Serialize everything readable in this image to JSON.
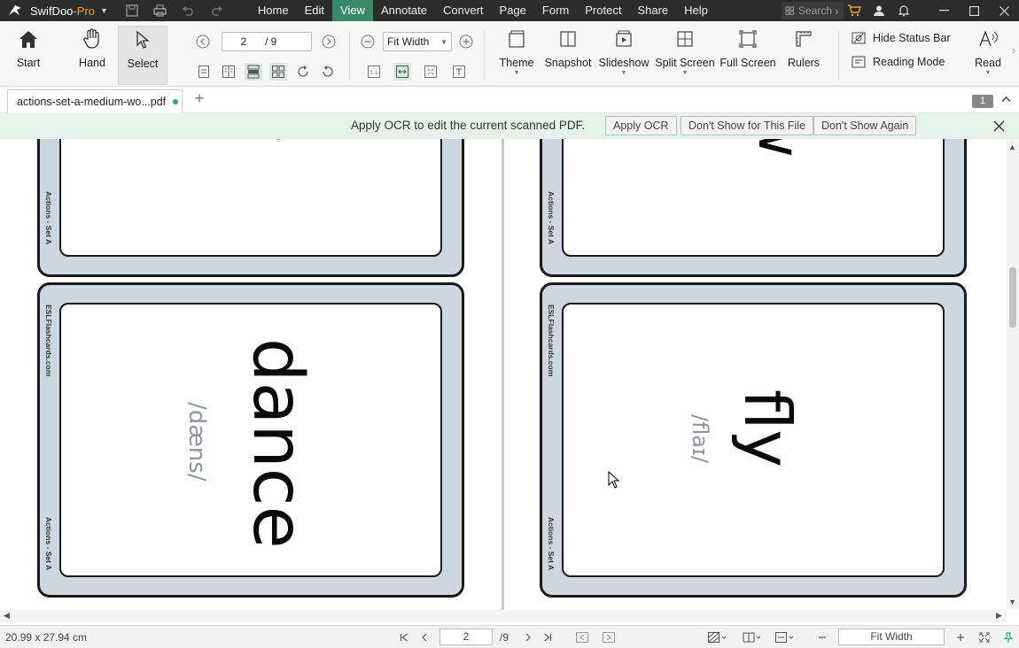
{
  "app": {
    "name": "SwifDoo",
    "edition": "-Pro"
  },
  "menu": [
    "Home",
    "Edit",
    "View",
    "Annotate",
    "Convert",
    "Page",
    "Form",
    "Protect",
    "Share",
    "Help"
  ],
  "menu_active": "View",
  "search": {
    "placeholder": "Search"
  },
  "ribbon": {
    "start": "Start",
    "hand": "Hand",
    "select": "Select",
    "page_current": "2",
    "page_total": "/ 9",
    "zoom": "Fit Width",
    "theme": "Theme",
    "snapshot": "Snapshot",
    "slideshow": "Slideshow",
    "split_screen": "Split Screen",
    "full_screen": "Full Screen",
    "rulers": "Rulers",
    "hide_status_bar": "Hide Status Bar",
    "reading_mode": "Reading Mode",
    "read": "Read"
  },
  "tab": {
    "title": "actions-set-a-medium-wo...pdf",
    "badge": "1"
  },
  "ocr_banner": {
    "message": "Apply OCR to edit the current scanned PDF.",
    "apply": "Apply OCR",
    "dont_show_file": "Don't Show for This File",
    "dont_show_again": "Don't Show Again"
  },
  "cards": {
    "brand": "ESLFlashcards.com",
    "set": "Actions - Set A",
    "left_top_word": "y",
    "right_top_word": "w",
    "left_word": "dance",
    "left_phonetic": "/dæns/",
    "right_word": "fly",
    "right_phonetic": "/flaɪ/"
  },
  "status": {
    "dimensions": "20.99 x 27.94 cm",
    "page_current": "2",
    "page_total": "/9",
    "zoom": "Fit Width"
  }
}
